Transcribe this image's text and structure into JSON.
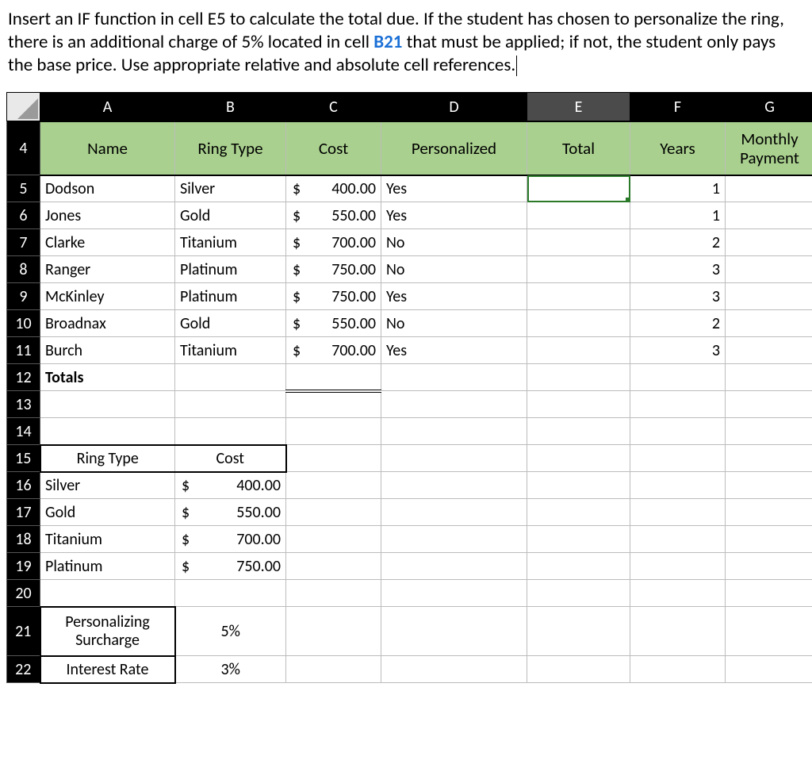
{
  "question": {
    "part1": "Insert an IF function in cell E5 to calculate the total due. If the student has chosen to personalize the ring, there is an additional charge of 5% located in cell ",
    "b21": "B21",
    "part2": " that must be applied; if not, the student only pays the base price. Use appropriate relative and absolute cell references."
  },
  "columns": [
    "A",
    "B",
    "C",
    "D",
    "E",
    "F",
    "G"
  ],
  "header_row_num": "4",
  "headers": {
    "A": "Name",
    "B": "Ring Type",
    "C": "Cost",
    "D": "Personalized",
    "E": "Total",
    "F": "Years",
    "G": "Monthly Payment"
  },
  "rows": [
    {
      "num": "5",
      "name": "Dodson",
      "ring": "Silver",
      "cost": "400.00",
      "pers": "Yes",
      "years": "1"
    },
    {
      "num": "6",
      "name": "Jones",
      "ring": "Gold",
      "cost": "550.00",
      "pers": "Yes",
      "years": "1"
    },
    {
      "num": "7",
      "name": "Clarke",
      "ring": "Titanium",
      "cost": "700.00",
      "pers": "No",
      "years": "2"
    },
    {
      "num": "8",
      "name": "Ranger",
      "ring": "Platinum",
      "cost": "750.00",
      "pers": "No",
      "years": "3"
    },
    {
      "num": "9",
      "name": "McKinley",
      "ring": "Platinum",
      "cost": "750.00",
      "pers": "Yes",
      "years": "3"
    },
    {
      "num": "10",
      "name": "Broadnax",
      "ring": "Gold",
      "cost": "550.00",
      "pers": "No",
      "years": "2"
    },
    {
      "num": "11",
      "name": "Burch",
      "ring": "Titanium",
      "cost": "700.00",
      "pers": "Yes",
      "years": "3"
    }
  ],
  "totals_row": {
    "num": "12",
    "label": "Totals"
  },
  "blank_rows": [
    "13",
    "14"
  ],
  "lookup_header_row": {
    "num": "15",
    "A": "Ring Type",
    "B": "Cost"
  },
  "lookup_rows": [
    {
      "num": "16",
      "ring": "Silver",
      "cost": "400.00"
    },
    {
      "num": "17",
      "ring": "Gold",
      "cost": "550.00"
    },
    {
      "num": "18",
      "ring": "Titanium",
      "cost": "700.00"
    },
    {
      "num": "19",
      "ring": "Platinum",
      "cost": "750.00"
    }
  ],
  "row20": "20",
  "surcharge_row": {
    "num": "21",
    "label_line1": "Personalizing",
    "label_line2": "Surcharge",
    "value": "5%"
  },
  "interest_row": {
    "num": "22",
    "label": "Interest Rate",
    "value": "3%"
  },
  "currency_symbol": "$"
}
